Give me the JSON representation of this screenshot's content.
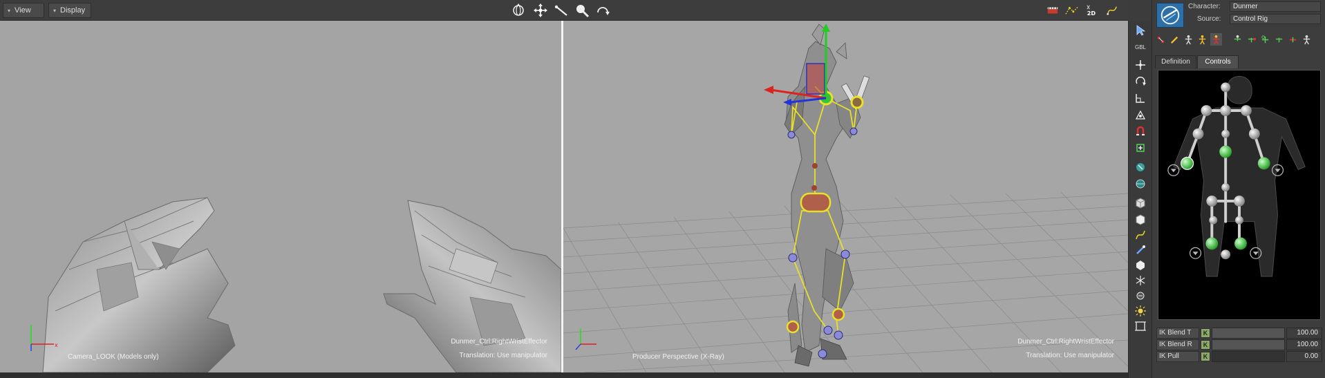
{
  "topbar": {
    "menus": [
      {
        "label": "View",
        "icon": "chevron-down-icon"
      },
      {
        "label": "Display",
        "icon": "chevron-down-icon"
      }
    ],
    "center_tools": [
      "orbit-icon",
      "move-icon",
      "pan-icon",
      "zoom-icon",
      "rotate-view-icon"
    ],
    "right_tools": [
      "filmstrip-icon",
      "path-icon",
      "2d-view-icon",
      "curve-icon"
    ],
    "right_tools_text": "2D"
  },
  "viewports": {
    "left": {
      "camera": "Camera_LOOK (Models only)",
      "selection": "Dunmer_Ctrl:RightWristEffector",
      "mode": "Translation: Use manipulator"
    },
    "right": {
      "camera": "Producer Perspective (X-Ray)",
      "selection": "Dunmer_Ctrl:RightWristEffector",
      "mode": "Translation: Use manipulator"
    }
  },
  "side_tools": {
    "gbl_label": "GBL",
    "icons": [
      "select-arrow-icon",
      "translate-icon",
      "rotate-icon",
      "scale-icon",
      "pivot-icon",
      "snap-icon",
      "layer-icon",
      "camera-icon",
      "globe-icon",
      "cube-icon",
      "cube-alt-icon",
      "curve-tool-icon",
      "pen-icon",
      "sphere-icon",
      "axis-icon",
      "light-icon",
      "sun-icon",
      "frame-icon"
    ]
  },
  "panel": {
    "character_label": "Character:",
    "character_value": "Dunmer",
    "source_label": "Source:",
    "source_value": "Control Rig",
    "logo_icon": "character-logo-icon",
    "tool_icons": [
      "pick-icon",
      "pencil-icon",
      "figure-icon",
      "figure-key-icon",
      "figure-pose-icon",
      "full-body-icon",
      "body-part-icon",
      "selection-icon",
      "mirror-icon",
      "pin-icon",
      "extra-icon"
    ],
    "tabs": [
      {
        "label": "Definition",
        "active": false
      },
      {
        "label": "Controls",
        "active": true
      }
    ],
    "ik": [
      {
        "label": "IK Blend T",
        "key": "K",
        "value": "100.00",
        "fraction": 1.0
      },
      {
        "label": "IK Blend R",
        "key": "K",
        "value": "100.00",
        "fraction": 1.0
      },
      {
        "label": "IK Pull",
        "key": "K",
        "value": "0.00",
        "fraction": 0.0
      }
    ]
  },
  "colors": {
    "viewport_bg": "#a6a6a6",
    "skeleton_line": "#e8e02a",
    "effector_green": "#35c23c",
    "axis_x": "#e01e1e",
    "axis_y": "#1ee01e",
    "axis_z": "#2a3fe0"
  }
}
